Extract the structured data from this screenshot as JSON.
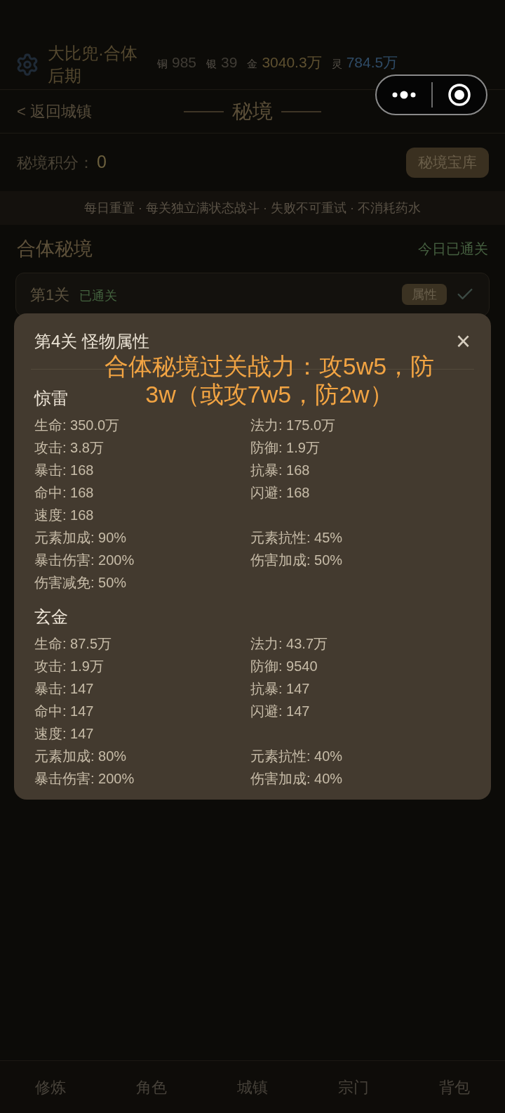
{
  "header": {
    "player_name": "大比兜·合体后期",
    "currencies": [
      {
        "label": "铜",
        "value": "985",
        "color": "#403c35"
      },
      {
        "label": "银",
        "value": "39",
        "color": "#403c35"
      },
      {
        "label": "金",
        "value": "3040.3万",
        "color": "#5e5030"
      },
      {
        "label": "灵",
        "value": "784.5万",
        "color": "#2f4b66"
      }
    ]
  },
  "nav": {
    "back": "< 返回城镇",
    "title": "秘境"
  },
  "score": {
    "label": "秘境积分：",
    "value": "0",
    "button": "秘境宝库"
  },
  "notice": "每日重置 · 每关独立满状态战斗 · 失败不可重试 · 不消耗药水",
  "section": {
    "title": "合体秘境",
    "status": "今日已通关"
  },
  "stages": [
    {
      "name": "第1关",
      "status": "已通关",
      "button": "属性"
    }
  ],
  "modal": {
    "title": "第4关 怪物属性",
    "close": "×",
    "caption": "合体秘境过关战力：攻5w5，防3w（或攻7w5，防2w）",
    "monsters": [
      {
        "name": "惊雷",
        "stats": [
          {
            "left": "生命: 350.0万",
            "right": "法力: 175.0万"
          },
          {
            "left": "攻击: 3.8万",
            "right": "防御: 1.9万"
          },
          {
            "left": "暴击: 168",
            "right": "抗暴: 168"
          },
          {
            "left": "命中: 168",
            "right": "闪避: 168"
          },
          {
            "left": "速度: 168"
          },
          {
            "left": "元素加成: 90%",
            "right": "元素抗性: 45%"
          },
          {
            "left": "暴击伤害: 200%",
            "right": "伤害加成: 50%"
          },
          {
            "left": "伤害减免: 50%"
          }
        ]
      },
      {
        "name": "玄金",
        "stats": [
          {
            "left": "生命: 87.5万",
            "right": "法力: 43.7万"
          },
          {
            "left": "攻击: 1.9万",
            "right": "防御: 9540"
          },
          {
            "left": "暴击: 147",
            "right": "抗暴: 147"
          },
          {
            "left": "命中: 147",
            "right": "闪避: 147"
          },
          {
            "left": "速度: 147"
          },
          {
            "left": "元素加成: 80%",
            "right": "元素抗性: 40%"
          },
          {
            "left": "暴击伤害: 200%",
            "right": "伤害加成: 40%"
          }
        ]
      }
    ]
  },
  "bottom_nav": [
    {
      "label": "修炼"
    },
    {
      "label": "角色"
    },
    {
      "label": "城镇"
    },
    {
      "label": "宗门"
    },
    {
      "label": "背包"
    }
  ]
}
